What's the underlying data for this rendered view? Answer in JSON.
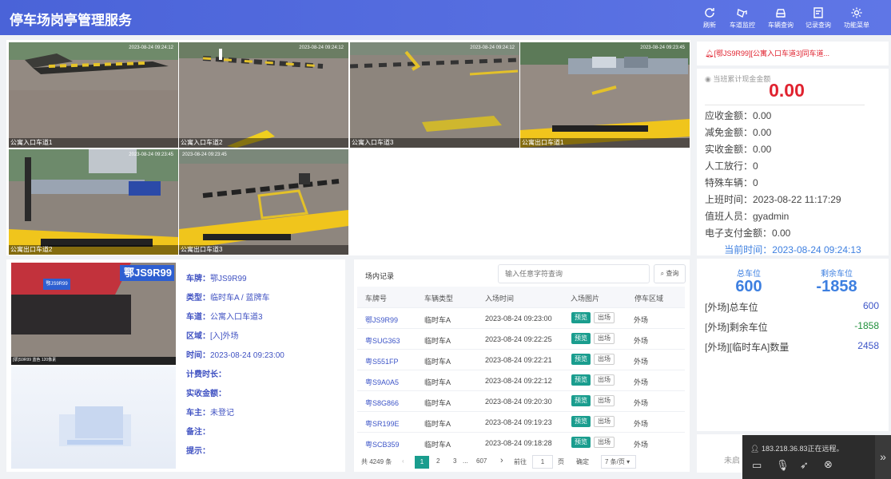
{
  "app": {
    "title": "停车场岗亭管理服务"
  },
  "toolbar": [
    {
      "label": "刷新",
      "icon": "refresh-icon"
    },
    {
      "label": "车道监控",
      "icon": "monitor-icon"
    },
    {
      "label": "车辆查询",
      "icon": "car-icon"
    },
    {
      "label": "记录查询",
      "icon": "record-icon"
    },
    {
      "label": "功能菜单",
      "icon": "gear-icon"
    }
  ],
  "cameras": [
    {
      "label": "公寓入口车道1",
      "ts": "2023-08-24 09:24:12",
      "side": "left"
    },
    {
      "label": "公寓入口车道2",
      "ts": "2023-08-24 09:24:12",
      "side": "left"
    },
    {
      "label": "公寓入口车道3",
      "ts": "2023-08-24 09:24:12",
      "side": "left"
    },
    {
      "label": "公寓出口车道1",
      "ts": "2023-08-24 09:23:45",
      "side": "right"
    },
    {
      "label": "公寓出口车道2",
      "ts": "2023-08-24 09:23:45",
      "side": "right"
    },
    {
      "label": "公寓出口车道3",
      "ts": "2023-08-24 09:23:45",
      "side": "right"
    }
  ],
  "alert": {
    "text": "[鄂JS9R99][公寓入口车道3]同车道..."
  },
  "stats": {
    "title": "当班累计现金金额",
    "amount": "0.00",
    "rows": [
      "应收金额：0.00",
      "减免金额：0.00",
      "实收金额：0.00",
      "人工放行：0",
      "特殊车辆：0",
      "上班时间：2023-08-22 11:17:29",
      "值班人员：gyadmin",
      "电子支付金额：0.00"
    ],
    "current_time": "当前时间：2023-08-24 09:24:13"
  },
  "spaces": {
    "total_label": "总车位",
    "total": "600",
    "remain_label": "剩余车位",
    "remain": "-1858",
    "rows": [
      {
        "label": "[外场]总车位",
        "value": "600"
      },
      {
        "label": "[外场]剩余车位",
        "value": "-1858"
      },
      {
        "label": "[外场][临时车A]数量",
        "value": "2458"
      }
    ],
    "bottom_text": "未启"
  },
  "detail": {
    "plate_img": "鄂JS9R99",
    "small_plate": "鄂JS9R99",
    "caption": "[鄂]S9R99 蓝色 120像素",
    "rows": [
      {
        "k": "车牌：",
        "v": "鄂JS9R99"
      },
      {
        "k": "类型：",
        "v": "临时车A / 蓝牌车"
      },
      {
        "k": "车道：",
        "v": "公寓入口车道3"
      },
      {
        "k": "区域：",
        "v": "[入]外场"
      },
      {
        "k": "时间：",
        "v": "2023-08-24 09:23:00"
      },
      {
        "k": "计费时长：",
        "v": ""
      },
      {
        "k": "实收金额：",
        "v": ""
      },
      {
        "k": "车主：",
        "v": "未登记"
      },
      {
        "k": "备注：",
        "v": ""
      },
      {
        "k": "提示：",
        "v": ""
      }
    ]
  },
  "records": {
    "title": "场内记录",
    "search_placeholder": "输入任意字符查询",
    "search_btn": "查询",
    "headers": [
      "车牌号",
      "车辆类型",
      "入场时间",
      "入场图片",
      "停车区域"
    ],
    "pre_label": "预览",
    "out_label": "出场",
    "rows": [
      {
        "plate": "鄂JS9R99",
        "type": "临时车A",
        "time": "2023-08-24 09:23:00",
        "area": "外场"
      },
      {
        "plate": "粤SUG363",
        "type": "临时车A",
        "time": "2023-08-24 09:22:25",
        "area": "外场"
      },
      {
        "plate": "粤S551FP",
        "type": "临时车A",
        "time": "2023-08-24 09:22:21",
        "area": "外场"
      },
      {
        "plate": "粤S9A0A5",
        "type": "临时车A",
        "time": "2023-08-24 09:22:12",
        "area": "外场"
      },
      {
        "plate": "粤S8G866",
        "type": "临时车A",
        "time": "2023-08-24 09:20:30",
        "area": "外场"
      },
      {
        "plate": "粤SR199E",
        "type": "临时车A",
        "time": "2023-08-24 09:19:23",
        "area": "外场"
      },
      {
        "plate": "粤SCB359",
        "type": "临时车A",
        "time": "2023-08-24 09:18:28",
        "area": "外场"
      }
    ],
    "pager": {
      "total": "共 4249 条",
      "pages": [
        "1",
        "2",
        "3",
        "...",
        "607"
      ],
      "goto": "前往",
      "page_input": "1",
      "page_unit": "页",
      "confirm": "确定",
      "size": "7 条/页"
    }
  },
  "remote": {
    "text": "183.218.36.83正在远程。"
  }
}
